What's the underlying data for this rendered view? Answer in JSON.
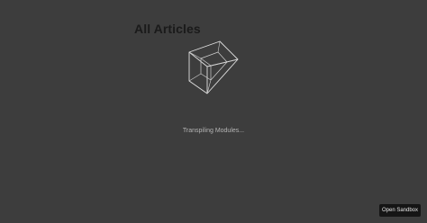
{
  "page": {
    "title": "All Articles"
  },
  "loader": {
    "icon": "cube-icon",
    "status_text": "Transpiling Modules..."
  },
  "sandbox": {
    "open_label": "Open Sandbox"
  },
  "colors": {
    "background": "#3d3d3d",
    "title": "#1a1a1a",
    "status_text": "#b5b5b5",
    "button_bg": "#151515",
    "button_text": "#e6e6e6",
    "cube_stroke": "#e0e0e0"
  }
}
